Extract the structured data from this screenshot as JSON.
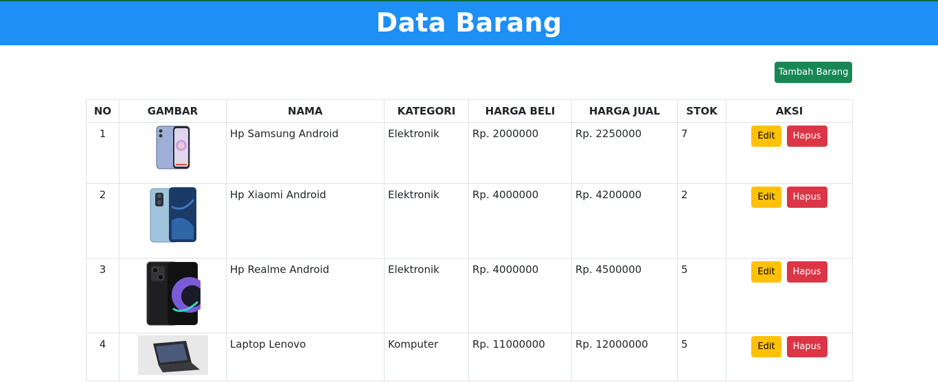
{
  "page": {
    "title": "Data Barang"
  },
  "toolbar": {
    "add_label": "Tambah Barang"
  },
  "table": {
    "headers": [
      "NO",
      "GAMBAR",
      "NAMA",
      "KATEGORI",
      "HARGA BELI",
      "HARGA JUAL",
      "STOK",
      "AKSI"
    ],
    "rows": [
      {
        "no": "1",
        "image": "samsung-phone",
        "nama": "Hp Samsung Android",
        "kategori": "Elektronik",
        "harga_beli": "Rp. 2000000",
        "harga_jual": "Rp. 2250000",
        "stok": "7",
        "edit": "Edit",
        "hapus": "Hapus"
      },
      {
        "no": "2",
        "image": "xiaomi-phone",
        "nama": "Hp Xiaomi Android",
        "kategori": "Elektronik",
        "harga_beli": "Rp. 4000000",
        "harga_jual": "Rp. 4200000",
        "stok": "2",
        "edit": "Edit",
        "hapus": "Hapus"
      },
      {
        "no": "3",
        "image": "realme-phone",
        "nama": "Hp Realme Android",
        "kategori": "Elektronik",
        "harga_beli": "Rp. 4000000",
        "harga_jual": "Rp. 4500000",
        "stok": "5",
        "edit": "Edit",
        "hapus": "Hapus"
      },
      {
        "no": "4",
        "image": "lenovo-laptop",
        "nama": "Laptop Lenovo",
        "kategori": "Komputer",
        "harga_beli": "Rp. 11000000",
        "harga_jual": "Rp. 12000000",
        "stok": "5",
        "edit": "Edit",
        "hapus": "Hapus"
      }
    ]
  },
  "colors": {
    "header": "#1e8ff5",
    "add": "#198754",
    "edit": "#ffc107",
    "delete": "#dc3545"
  }
}
